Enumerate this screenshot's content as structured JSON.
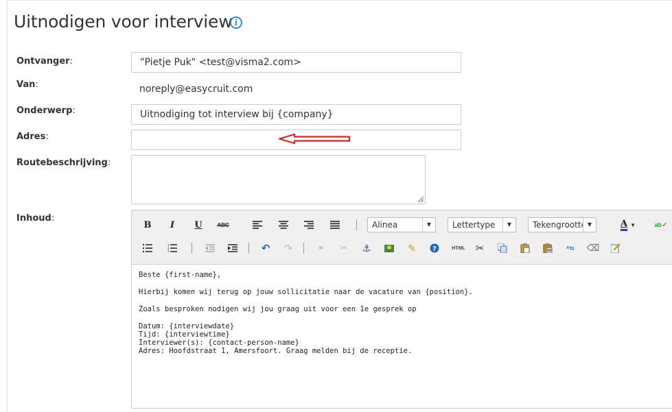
{
  "page": {
    "title": "Uitnodigen voor interview"
  },
  "form": {
    "to_label": "Ontvanger",
    "to_value": "\"Pietje  Puk\" <test@visma2.com>",
    "from_label": "Van",
    "from_value": "noreply@easycruit.com",
    "subject_label": "Onderwerp",
    "subject_value": "Uitnodiging tot interview bij {company}",
    "address_label": "Adres",
    "address_value": "",
    "route_label": "Routebeschrijving",
    "route_value": "",
    "content_label": "Inhoud",
    "colon": ":"
  },
  "editor": {
    "format_select": "Alinea",
    "font_select": "Lettertype",
    "size_select": "Tekengrootte",
    "html_button": "HTML",
    "content_lines": [
      "Beste {first-name},",
      "Hierbij komen wij terug op jouw sollicitatie naar de vacature van {position}.",
      "Zoals besproken nodigen wij jou graag uit voor een 1e gesprek op",
      "Datum: {interviewdate}",
      "Tijd: {interviewtime}",
      "Interviewer(s): {contact-person-name}",
      "Adres: Hoofdstraat 1, Amersfoort. Graag melden bij de receptie."
    ]
  },
  "colors": {
    "accent": "#2a8fd8",
    "annotation_arrow": "#e0201e"
  }
}
